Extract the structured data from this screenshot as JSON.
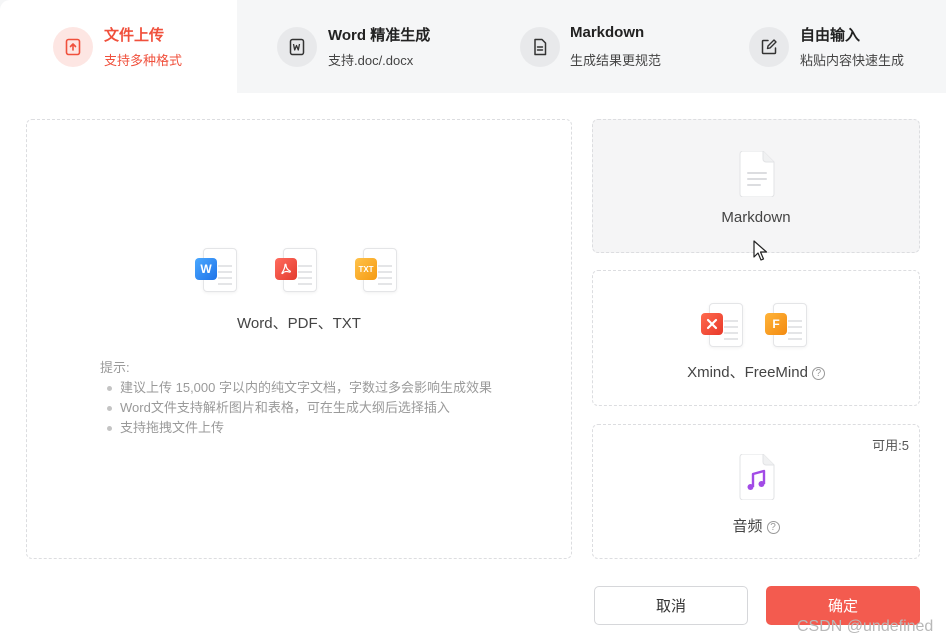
{
  "tabs": [
    {
      "title": "文件上传",
      "subtitle": "支持多种格式",
      "icon": "upload-icon",
      "active": true
    },
    {
      "title": "Word 精准生成",
      "subtitle": "支持.doc/.docx",
      "icon": "word-icon",
      "active": false
    },
    {
      "title": "Markdown",
      "subtitle": "生成结果更规范",
      "icon": "markdown-icon",
      "active": false
    },
    {
      "title": "自由输入",
      "subtitle": "粘贴内容快速生成",
      "icon": "edit-icon",
      "active": false
    }
  ],
  "upload_area": {
    "file_types_label": "Word、PDF、TXT",
    "file_icons": [
      "word-file-icon",
      "pdf-file-icon",
      "txt-file-icon"
    ],
    "tips_title": "提示:",
    "tips": [
      "建议上传 15,000 字以内的纯文字文档，字数过多会影响生成效果",
      "Word文件支持解析图片和表格，可在生成大纲后选择插入",
      "支持拖拽文件上传"
    ]
  },
  "options": {
    "markdown": {
      "label": "Markdown",
      "icon": "markdown-file-icon"
    },
    "mindmap": {
      "label": "Xmind、FreeMind",
      "icons": [
        "xmind-file-icon",
        "freemind-file-icon"
      ],
      "help": "?"
    },
    "audio": {
      "label": "音频",
      "icon": "audio-file-icon",
      "help": "?",
      "available": "可用:5"
    }
  },
  "buttons": {
    "cancel": "取消",
    "confirm": "确定"
  },
  "watermark": "CSDN @undefined",
  "colors": {
    "accent": "#f0503c",
    "confirm": "#f35b4f",
    "tab_bg": "#f5f6f7",
    "word": "#2f8ef4",
    "pdf": "#e8493b",
    "txt": "#f5a623",
    "xmind": "#f0503c",
    "freemind": "#f7a21b",
    "audio": "#a24be6"
  }
}
